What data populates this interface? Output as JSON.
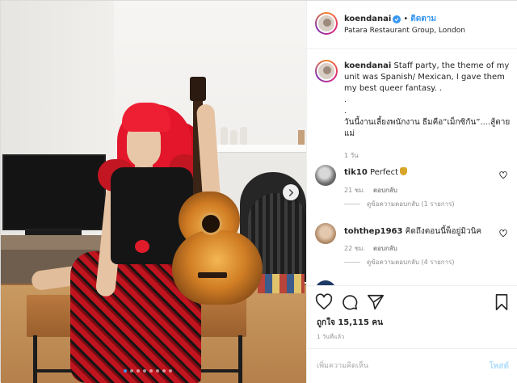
{
  "post": {
    "username": "koendanai",
    "follow_label": "ติดตาม",
    "separator": "•",
    "location": "Patara Restaurant Group, London",
    "caption": "Staff party, the theme of my unit was Spanish/ Mexican, I gave them my best queer fantasy. .\n.\n.\nวันนี้งานเลี้ยงพนักงาน ธีมคือ“เม็กซิกัน”....สู้ตายแม่",
    "caption_time": "1 วัน",
    "comments": [
      {
        "username": "tik10",
        "text": "Perfect",
        "time": "21 ชม.",
        "reply_label": "ตอบกลับ",
        "view_replies": "ดูข้อความตอบกลับ (1 รายการ)"
      },
      {
        "username": "tohthep1963",
        "text": "คิดถึงตอนนี้พ็อยู่มิวนิค",
        "time": "22 ชม.",
        "reply_label": "ตอบกลับ",
        "view_replies": "ดูข้อความตอบกลับ (4 รายการ)"
      }
    ],
    "likes_label": "ถูกใจ 15,115 คน",
    "time_ago": "1 วันที่แล้ว",
    "add_comment_placeholder": "เพิ่มความคิดเห็น",
    "post_button": "โพสต์",
    "carousel": {
      "total": 8,
      "active_index": 0
    }
  },
  "colors": {
    "link_blue": "#3897f0",
    "post_button_disabled": "#b2dffc",
    "muted_text": "#8e8e8e",
    "border": "#efefef"
  },
  "icons": [
    "verified-badge-icon",
    "heart-icon",
    "comment-icon",
    "share-icon",
    "bookmark-icon",
    "carousel-next-icon",
    "emoji-money-bag-icon"
  ]
}
